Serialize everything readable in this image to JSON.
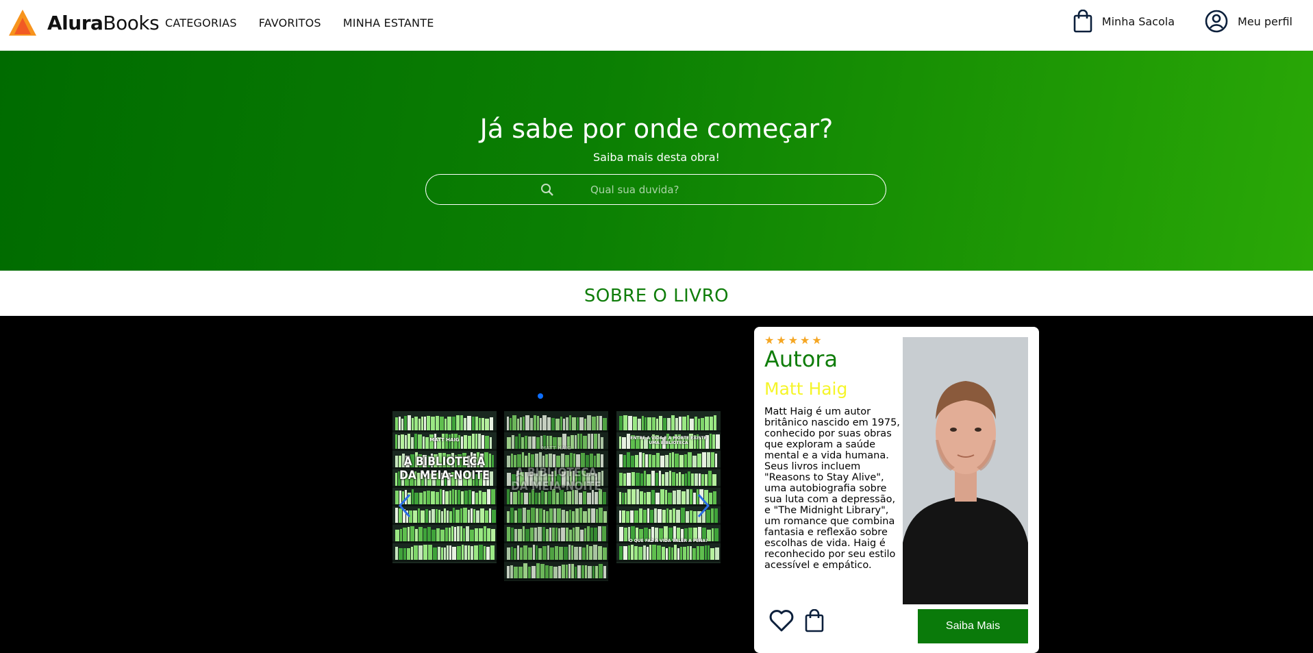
{
  "brand": {
    "name_bold": "Alura",
    "name_light": "Books"
  },
  "nav": {
    "items": [
      "CATEGORIAS",
      "FAVORITOS",
      "MINHA ESTANTE"
    ]
  },
  "header_right": {
    "bag_label": "Minha Sacola",
    "profile_label": "Meu perfil"
  },
  "hero": {
    "title": "Já sabe por onde começar?",
    "subtitle": "Saiba mais desta obra!",
    "search_placeholder": "Qual sua duvida?"
  },
  "section": {
    "title": "SOBRE O LIVRO"
  },
  "book": {
    "author_short": "MATT HAIG",
    "title_line1": "A BIBLIOTECA",
    "title_line2": "DA MEIA-NOITE",
    "back_heading": "ENTRE A VIDA E A MORTE EXISTE UMA BIBLIOTECA",
    "back_footer": "O QUE FAZ A VIDA VALER A PENA?"
  },
  "author_card": {
    "stars": "★★★★★",
    "heading": "Autora",
    "name": "Matt Haig",
    "bio": "Matt Haig é um autor britânico nascido em 1975, conhecido por suas obras que exploram a saúde mental e a vida humana. Seus livros incluem \"Reasons to Stay Alive\", uma autobiografia sobre sua luta com a depressão, e \"The Midnight Library\", um romance que combina fantasia e reflexão sobre escolhas de vida. Haig é reconhecido por seu estilo acessível e empático.",
    "button": "Saiba Mais"
  },
  "colors": {
    "brand_green": "#0f7d0a",
    "accent_yellow": "#f5f52a",
    "star": "#f5a623",
    "carousel_blue": "#0d6efd"
  }
}
